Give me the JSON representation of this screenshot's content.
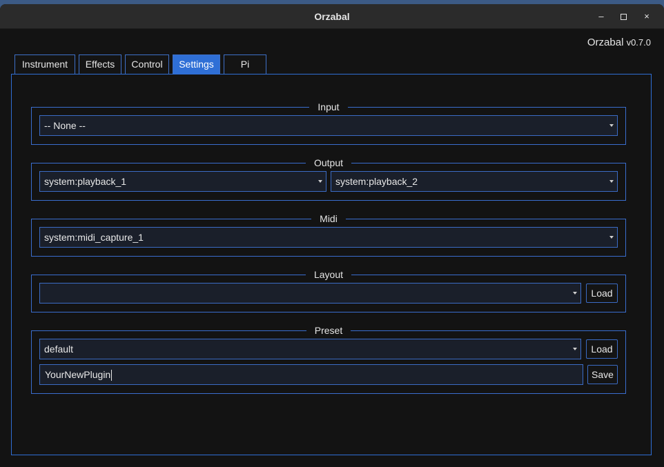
{
  "window": {
    "title": "Orzabal",
    "minimize_glyph": "–",
    "close_glyph": "×"
  },
  "header": {
    "app_name": "Orzabal",
    "version": "v0.7.0"
  },
  "tabs": [
    {
      "label": "Instrument",
      "active": false
    },
    {
      "label": "Effects",
      "active": false
    },
    {
      "label": "Control",
      "active": false
    },
    {
      "label": "Settings",
      "active": true
    },
    {
      "label": "Pi",
      "active": false
    }
  ],
  "settings": {
    "input": {
      "title": "Input",
      "selected": "-- None --"
    },
    "output": {
      "title": "Output",
      "left_selected": "system:playback_1",
      "right_selected": "system:playback_2"
    },
    "midi": {
      "title": "Midi",
      "selected": "system:midi_capture_1"
    },
    "layout": {
      "title": "Layout",
      "selected": "",
      "load_label": "Load"
    },
    "preset": {
      "title": "Preset",
      "selected": "default",
      "load_label": "Load",
      "name_value": "YourNewPlugin",
      "save_label": "Save"
    }
  },
  "colors": {
    "accent": "#2f6fd6",
    "background": "#131313",
    "field": "#1a1f2a"
  }
}
